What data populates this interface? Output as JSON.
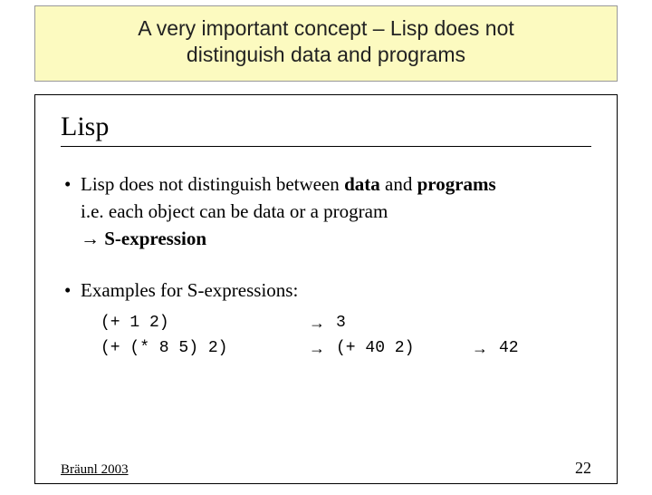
{
  "banner": {
    "line1": "A very important concept – Lisp does not",
    "line2": "distinguish data and programs"
  },
  "slide": {
    "title": "Lisp",
    "bullet1": {
      "pre": "Lisp does not distinguish between ",
      "bold1": "data",
      "mid": " and ",
      "bold2": "programs",
      "line2": "i.e. each object can be data or a program",
      "arrow": "→",
      "bold3": "S-expression"
    },
    "bullet2": {
      "text": "Examples for S-expressions:"
    },
    "examples": [
      {
        "expr": "(+ 1 2)",
        "arrow1": "→",
        "res1": "3",
        "arrow2": "",
        "res2": ""
      },
      {
        "expr": "(+ (* 8 5) 2)",
        "arrow1": "→",
        "res1": "(+ 40 2)",
        "arrow2": "→",
        "res2": "42"
      }
    ],
    "footer_left": "Bräunl 2003",
    "footer_right": "22"
  }
}
